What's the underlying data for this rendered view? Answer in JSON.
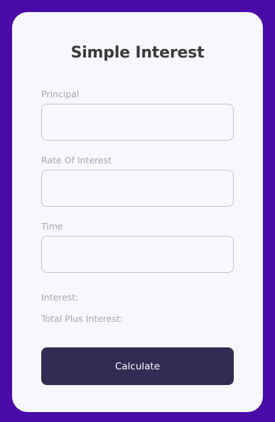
{
  "app": {
    "title": "Simple Interest"
  },
  "form": {
    "principal": {
      "label": "Principal",
      "value": "",
      "placeholder": ""
    },
    "rate": {
      "label": "Rate Of Interest",
      "value": "",
      "placeholder": ""
    },
    "time": {
      "label": "Time",
      "value": "",
      "placeholder": ""
    }
  },
  "results": {
    "interest_label": "Interest:",
    "total_label": "Total Plus Interest:"
  },
  "actions": {
    "calculate_label": "Calculate"
  },
  "colors": {
    "background": "#4a0aa8",
    "card": "#f6f8fd",
    "button": "#342b54",
    "title": "#3b3b3b",
    "label": "#a6a6ad"
  }
}
